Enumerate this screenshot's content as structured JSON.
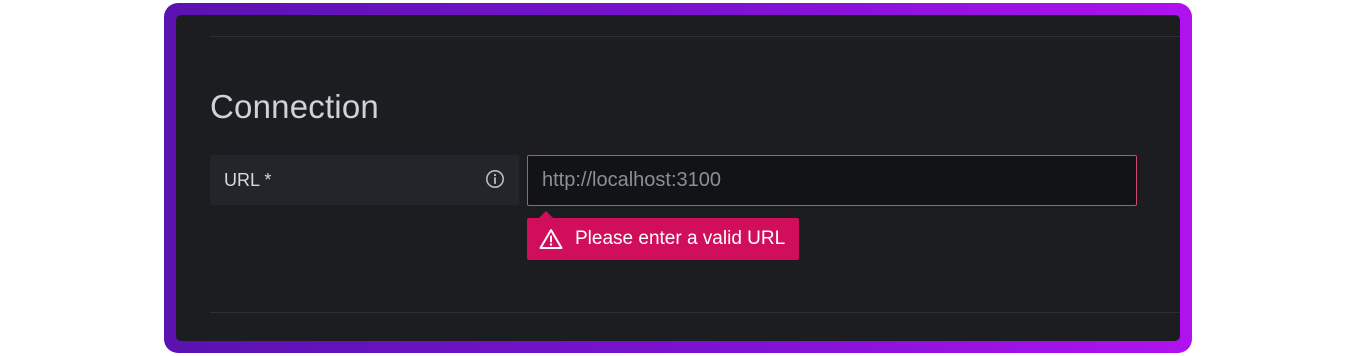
{
  "section": {
    "title": "Connection"
  },
  "url_field": {
    "label": "URL *",
    "placeholder": "http://localhost:3100",
    "value": "",
    "info_icon": "info-circle-icon",
    "error_message": "Please enter a valid URL",
    "error_icon": "warning-triangle-icon"
  },
  "colors": {
    "frame_gradient_start": "#5a12b0",
    "frame_gradient_end": "#b012ef",
    "panel_background": "#1c1d21",
    "error": "#d10e5c",
    "input_border_invalid": "#cf4a6e"
  }
}
